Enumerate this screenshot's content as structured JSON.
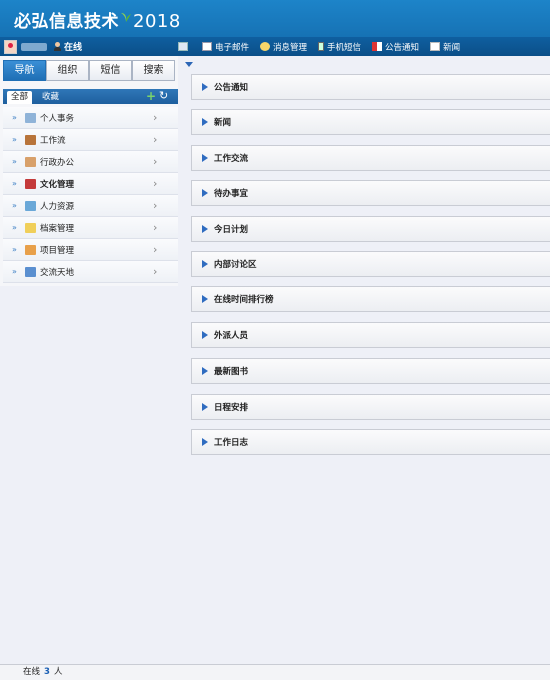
{
  "header": {
    "title": "必弘信息技术",
    "year": "2018"
  },
  "toolbar": {
    "online_label": "在线",
    "items": [
      {
        "icon": "contact-card-icon",
        "label": ""
      },
      {
        "icon": "mail-icon",
        "label": "电子邮件"
      },
      {
        "icon": "chat-bubble-icon",
        "label": "消息管理"
      },
      {
        "icon": "phone-icon",
        "label": "手机短信"
      },
      {
        "icon": "megaphone-icon",
        "label": "公告通知"
      },
      {
        "icon": "newspaper-icon",
        "label": "新闻"
      }
    ]
  },
  "left": {
    "tabs": [
      "导航",
      "组织",
      "短信",
      "搜索"
    ],
    "active_tab": "导航",
    "subtabs": {
      "all": "全部",
      "favorites": "收藏"
    },
    "menu": [
      {
        "label": "个人事务",
        "bold": false,
        "icon": "notepad-icon",
        "color": "#8fb3d8"
      },
      {
        "label": "工作流",
        "bold": false,
        "icon": "briefcase-icon",
        "color": "#b8743a"
      },
      {
        "label": "行政办公",
        "bold": false,
        "icon": "person-icon",
        "color": "#d8a06a"
      },
      {
        "label": "文化管理",
        "bold": true,
        "icon": "book-icon",
        "color": "#c43a3a"
      },
      {
        "label": "人力资源",
        "bold": false,
        "icon": "people-icon",
        "color": "#6aa8d8"
      },
      {
        "label": "档案管理",
        "bold": false,
        "icon": "folder-icon",
        "color": "#f0cf5a"
      },
      {
        "label": "项目管理",
        "bold": false,
        "icon": "envelope-icon",
        "color": "#e8a04a"
      },
      {
        "label": "交流天地",
        "bold": false,
        "icon": "documents-icon",
        "color": "#5a8fd0"
      }
    ]
  },
  "portlets": [
    "公告通知",
    "新闻",
    "工作交流",
    "待办事宜",
    "今日计划",
    "内部讨论区",
    "在线时间排行榜",
    "外派人员",
    "最新图书",
    "日程安排",
    "工作日志"
  ],
  "status": {
    "prefix": "在线",
    "count": "3",
    "suffix": "人"
  }
}
